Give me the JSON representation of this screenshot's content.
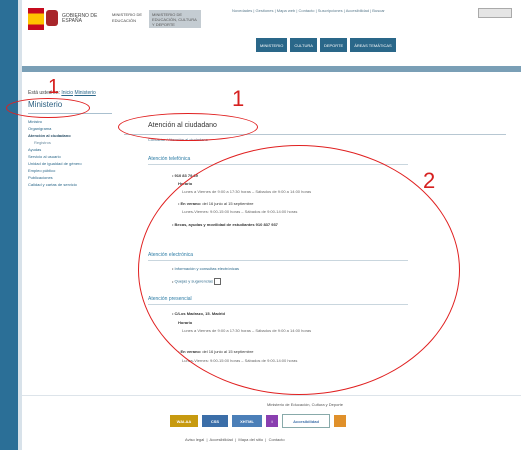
{
  "header": {
    "gov_label": "GOBIERNO DE ESPAÑA",
    "ministry_label": "MINISTERIO DE EDUCACIÓN",
    "logo_text": "MINISTERIO DE EDUCACIÓN, CULTURA Y DEPORTE",
    "util_links": "Novedades | Gestiones | Mapa web | Contacto | Suscripciones | Accesibilidad | Buscar",
    "nav_tabs": [
      "MINISTERIO",
      "CULTURA",
      "DEPORTE",
      "ÁREAS TEMÁTICAS"
    ]
  },
  "breadcrumb": {
    "prefix": "Está usted en:",
    "items": [
      "Inicio",
      "Ministerio"
    ]
  },
  "sidebar": {
    "title": "Ministerio",
    "items": [
      {
        "label": "Ministro",
        "type": "item"
      },
      {
        "label": "Organigrama",
        "type": "item"
      },
      {
        "label": "Atención al ciudadano",
        "type": "current"
      },
      {
        "label": "Registros",
        "type": "sub"
      },
      {
        "label": "Ayudas",
        "type": "item"
      },
      {
        "label": "Servicio al usuario",
        "type": "item"
      },
      {
        "label": "Unidad de igualdad de género",
        "type": "item"
      },
      {
        "label": "Empleo público",
        "type": "item"
      },
      {
        "label": "Publicaciones",
        "type": "item"
      },
      {
        "label": "Calidad y cartas de servicio",
        "type": "item"
      }
    ]
  },
  "main": {
    "title": "Atención al ciudadano",
    "subtitle": "Contactar / Atención al ciudadano",
    "sections": {
      "telefonica": {
        "heading": "Atención telefónica",
        "phone_label": "910 83 79 69",
        "horario_label": "Horario",
        "horario_text": "Lunes a Viernes de 9:00 a 17:30 horas – Sábados de 9:00 a 14:00 horas",
        "verano_label": "En verano:",
        "verano_text": "del 16 junio al 15 septiembre",
        "verano_detail": "Lunes-Viernes: 9:00-15:00 horas – Sábados de 9:00-14:00 horas",
        "becas_text": "Becas, ayudas y movilidad de estudiantes 910 837 937"
      },
      "electronica": {
        "heading": "Atención electrónica",
        "link1": "Información y consultas electrónicas",
        "link2": "Quejas y sugerencias"
      },
      "presencial": {
        "heading": "Atención presencial",
        "address": "C/Los Madrazo, 15. Madrid",
        "horario_label": "Horario",
        "horario_text": "Lunes a Viernes de 9:00 a 17:30 horas – Sábados de 9:00 a 14:00 horas",
        "verano_label": "En verano:",
        "verano_text": "del 16 junio al 15 septiembre",
        "verano_detail": "Lunes-Viernes: 9:00-15:00 horas – Sábados de 9:00-14:00 horas"
      }
    }
  },
  "footer": {
    "ministry_text": "Ministerio de Educación, Cultura y Deporte",
    "logos": [
      "WAI-AA",
      "CSS",
      "XHTML",
      "i",
      "Accesibilidad"
    ],
    "links": [
      "Aviso legal",
      "Accesibilidad",
      "Mapa del sitio",
      "Contacto"
    ]
  },
  "annotations": [
    {
      "label": "1"
    },
    {
      "label": "1"
    },
    {
      "label": "2"
    }
  ],
  "colors": {
    "brand_blue": "#2a6789",
    "annotation_red": "#e02020"
  }
}
